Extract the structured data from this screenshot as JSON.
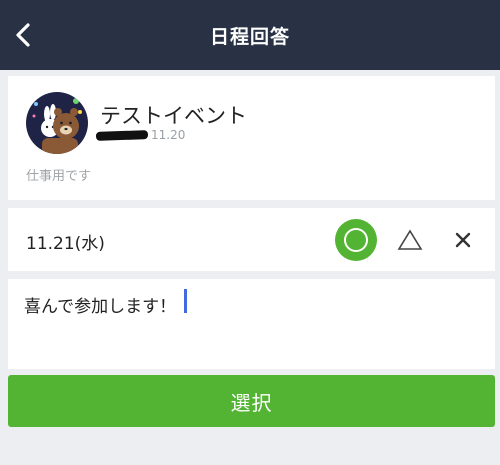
{
  "header": {
    "title": "日程回答",
    "back_icon": "chevron-left-icon"
  },
  "event": {
    "name": "テストイベント",
    "date": "11.20",
    "memo": "仕事用です",
    "avatar_icon": "bear-bunny-avatar"
  },
  "schedule": {
    "date_label": "11.21(水)",
    "options": [
      {
        "name": "attend",
        "icon": "circle-icon",
        "selected": true
      },
      {
        "name": "maybe",
        "icon": "triangle-icon",
        "selected": false
      },
      {
        "name": "absent",
        "icon": "cross-icon",
        "selected": false
      }
    ]
  },
  "comment": {
    "value": "喜んで参加します！"
  },
  "select_button": {
    "label": "選択"
  },
  "colors": {
    "header_bg": "#283244",
    "accent_green": "#53b332",
    "page_bg": "#eceef1",
    "caret": "#4169e1"
  }
}
